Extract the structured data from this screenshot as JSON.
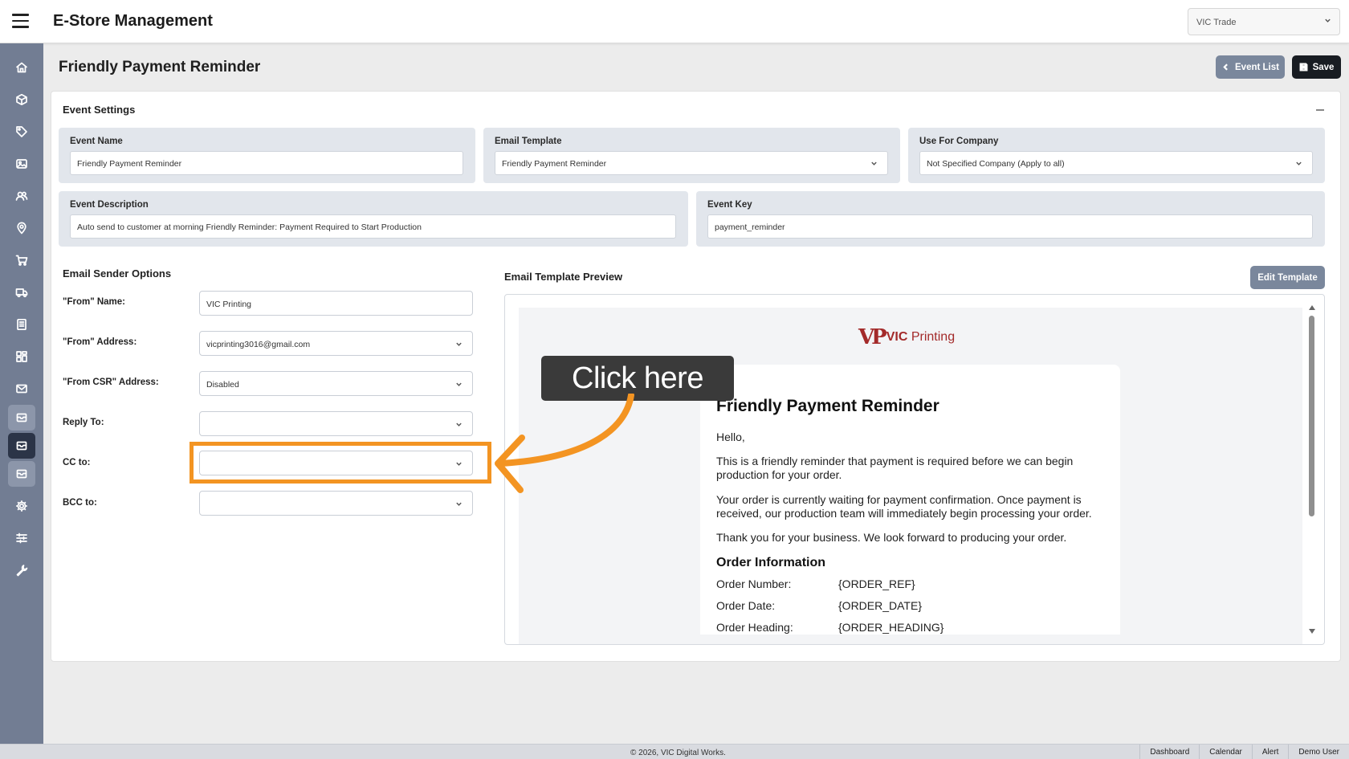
{
  "app": {
    "title": "E-Store Management",
    "company_select": "VIC Trade"
  },
  "sidebar": {
    "items": [
      {
        "icon": "home-icon"
      },
      {
        "icon": "box-icon"
      },
      {
        "icon": "tag-icon"
      },
      {
        "icon": "image-icon"
      },
      {
        "icon": "users-icon"
      },
      {
        "icon": "location-icon"
      },
      {
        "icon": "cart-icon"
      },
      {
        "icon": "truck-icon"
      },
      {
        "icon": "document-icon"
      },
      {
        "icon": "grid-icon"
      },
      {
        "icon": "mail-icon"
      },
      {
        "icon": "mail-icon"
      },
      {
        "icon": "mail-icon"
      },
      {
        "icon": "mail-icon"
      },
      {
        "icon": "gear-icon"
      },
      {
        "icon": "sliders-icon"
      },
      {
        "icon": "wrench-icon"
      }
    ]
  },
  "page": {
    "title": "Friendly Payment Reminder",
    "event_list_label": "Event List",
    "save_label": "Save"
  },
  "event_settings": {
    "title": "Event Settings",
    "event_name": {
      "label": "Event Name",
      "value": "Friendly Payment Reminder"
    },
    "email_template": {
      "label": "Email Template",
      "value": "Friendly Payment Reminder"
    },
    "use_for_company": {
      "label": "Use For Company",
      "value": "Not Specified Company (Apply to all)"
    },
    "event_description": {
      "label": "Event Description",
      "value": "Auto send to customer at morning Friendly Reminder: Payment Required to Start Production"
    },
    "event_key": {
      "label": "Event Key",
      "value": "payment_reminder"
    }
  },
  "sender_options": {
    "title": "Email Sender Options",
    "from_name": {
      "label": "\"From\" Name:",
      "value": "VIC Printing"
    },
    "from_address": {
      "label": "\"From\" Address:",
      "value": "vicprinting3016@gmail.com"
    },
    "from_csr": {
      "label": "\"From CSR\" Address:",
      "value": "Disabled"
    },
    "reply_to": {
      "label": "Reply To:",
      "value": ""
    },
    "cc_to": {
      "label": "CC to:",
      "value": ""
    },
    "bcc_to": {
      "label": "BCC to:",
      "value": ""
    }
  },
  "preview": {
    "title": "Email Template Preview",
    "edit_label": "Edit Template",
    "logo_mark": "VP",
    "logo_text_bold": "VIC",
    "logo_text": " Printing",
    "heading": "Friendly Payment Reminder",
    "greeting": "Hello,",
    "p1": "This is a friendly reminder that payment is required before we can begin production for your order.",
    "p2": "Your order is currently waiting for payment confirmation. Once payment is received, our production team will immediately begin processing your order.",
    "p3": "Thank you for your business. We look forward to producing your order.",
    "order_info_title": "Order Information",
    "order_rows": [
      {
        "label": "Order Number:",
        "value": "{ORDER_REF}"
      },
      {
        "label": "Order Date:",
        "value": "{ORDER_DATE}"
      },
      {
        "label": "Order Heading:",
        "value": "{ORDER_HEADING}"
      }
    ]
  },
  "callout": {
    "text": "Click here",
    "color": "#f39422"
  },
  "footer": {
    "copyright": "© 2026, VIC Digital Works.",
    "links": [
      "Dashboard",
      "Calendar",
      "Alert",
      "Demo User"
    ]
  }
}
